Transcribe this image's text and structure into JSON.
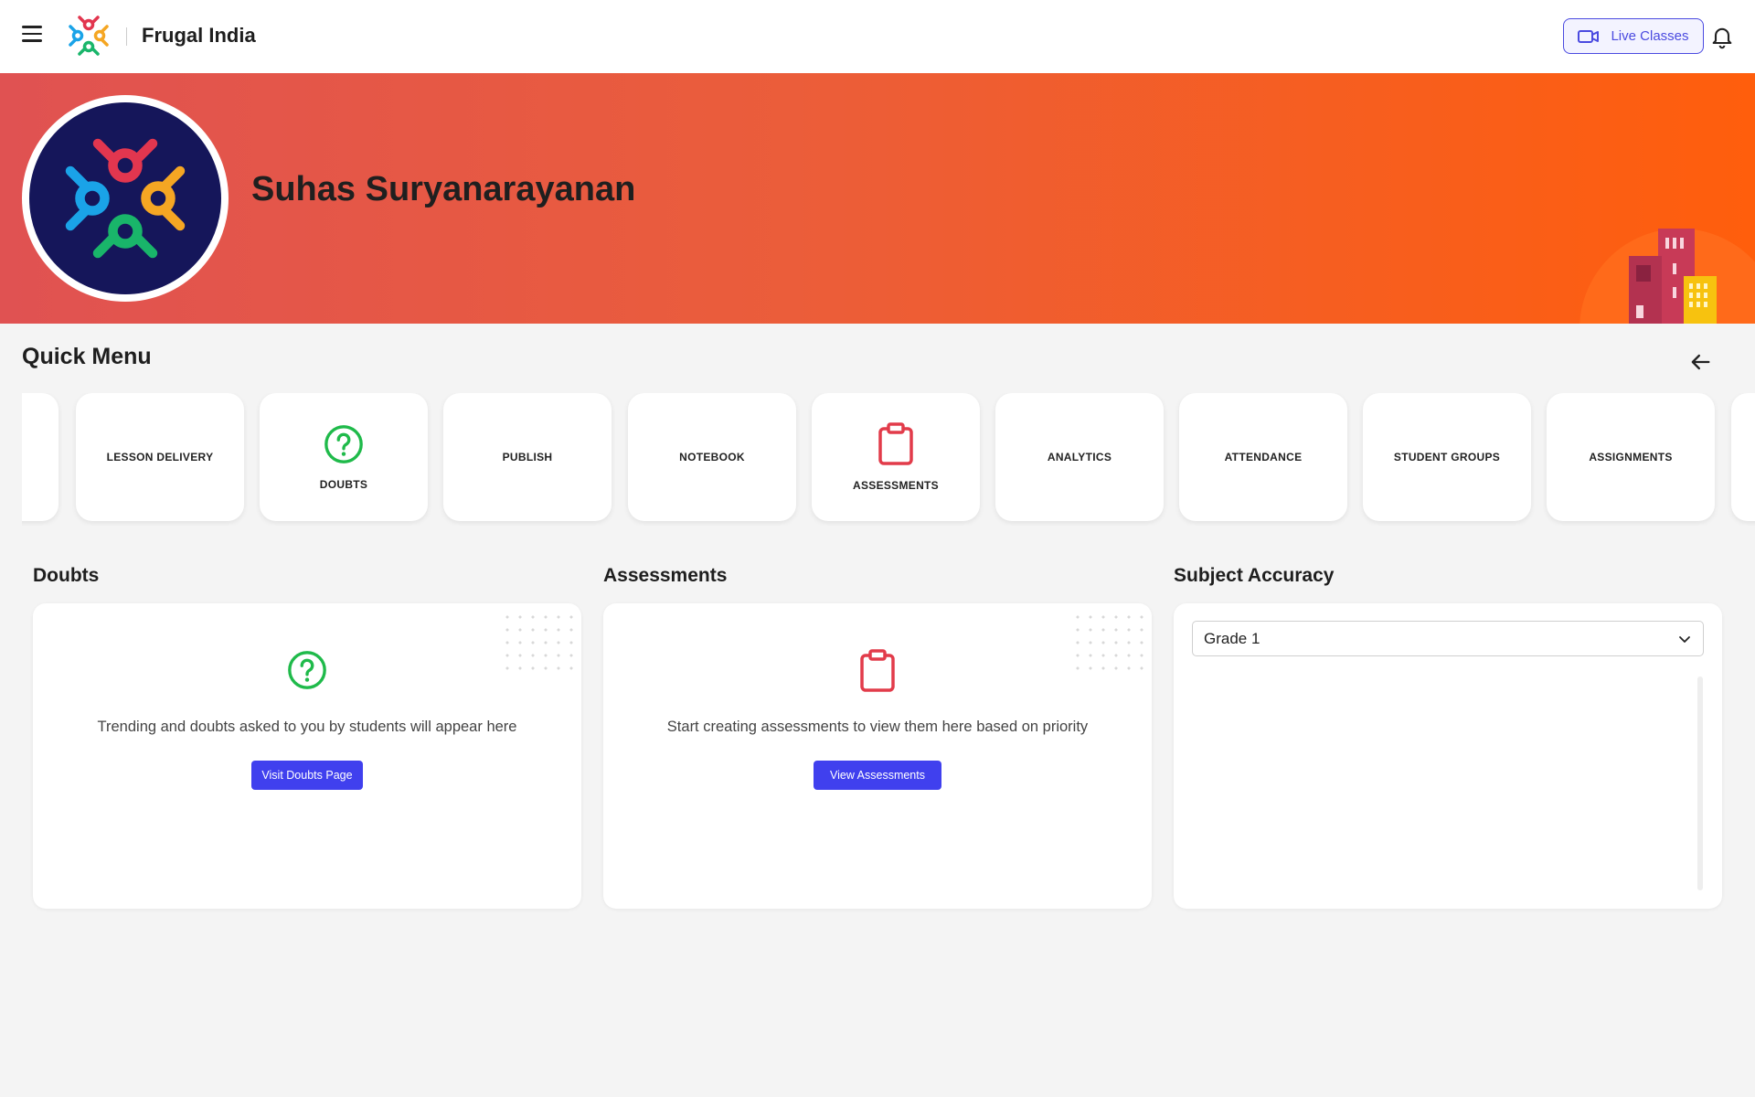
{
  "header": {
    "brand": "Frugal India",
    "live_classes_label": "Live Classes",
    "menu_icon": "hamburger-menu-icon",
    "bell_icon": "bell-icon"
  },
  "profile": {
    "name": "Suhas Suryanarayanan"
  },
  "quick_menu": {
    "title": "Quick Menu",
    "items": [
      {
        "label": "",
        "icon": ""
      },
      {
        "label": "LESSON DELIVERY",
        "icon": ""
      },
      {
        "label": "DOUBTS",
        "icon": "question-circle-icon"
      },
      {
        "label": "PUBLISH",
        "icon": ""
      },
      {
        "label": "NOTEBOOK",
        "icon": ""
      },
      {
        "label": "ASSESSMENTS",
        "icon": "clipboard-icon"
      },
      {
        "label": "ANALYTICS",
        "icon": ""
      },
      {
        "label": "ATTENDANCE",
        "icon": ""
      },
      {
        "label": "STUDENT GROUPS",
        "icon": ""
      },
      {
        "label": "ASSIGNMENTS",
        "icon": ""
      },
      {
        "label": "",
        "icon": ""
      }
    ]
  },
  "widgets": {
    "doubts": {
      "title": "Doubts",
      "message": "Trending and doubts asked to you by students will appear here",
      "button": "Visit Doubts Page"
    },
    "assessments": {
      "title": "Assessments",
      "message": "Start creating assessments to view them here based on priority",
      "button": "View Assessments"
    },
    "subject_accuracy": {
      "title": "Subject Accuracy",
      "grade_selected": "Grade 1"
    }
  },
  "colors": {
    "accent": "#4040ee",
    "banner_start": "#e05252",
    "banner_end": "#ff5e0c",
    "doubts_green": "#1fba4a",
    "assessments_red": "#e23b4a"
  }
}
